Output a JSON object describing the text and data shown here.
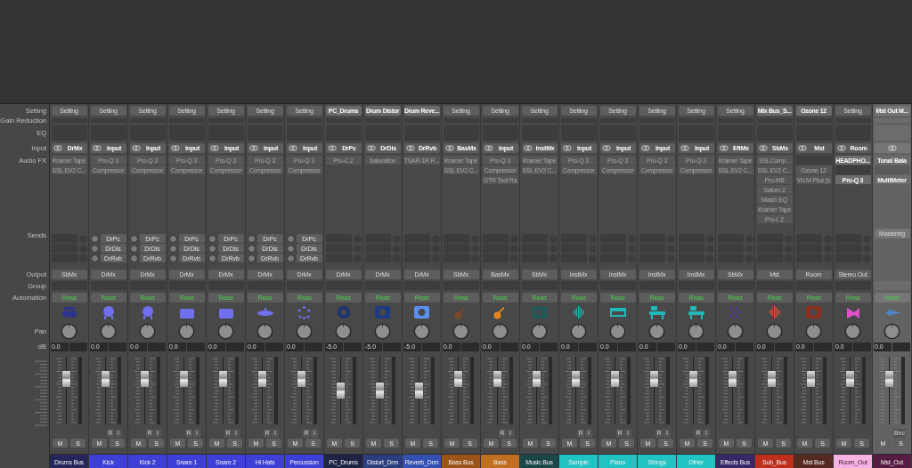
{
  "row_labels": {
    "setting": "Setting",
    "gain_reduction": "Gain Reduction",
    "eq": "EQ",
    "input": "Input",
    "audio_fx": "Audio FX",
    "sends": "Sends",
    "output": "Output",
    "group": "Group",
    "automation": "Automation",
    "pan": "Pan",
    "db": "dB"
  },
  "strips": [
    {
      "name": "Drums Bus",
      "color": "#25275a",
      "setting": "Setting",
      "setting_loaded": false,
      "input": "DrMx",
      "fx": [
        {
          "name": "Kramer Tape",
          "active": false
        },
        {
          "name": "SSL EV2 C...",
          "active": false
        }
      ],
      "output": "SbMx",
      "automation": "Read",
      "icon": {
        "kind": "drum-kit",
        "color": "#2d3290"
      },
      "db": "0.0",
      "level": 0.72,
      "ms": [
        "M",
        "S"
      ],
      "selected": false
    },
    {
      "name": "Kick",
      "color": "#3d3fd6",
      "setting": "Setting",
      "setting_loaded": false,
      "input": "Input",
      "fx": [
        {
          "name": "Pro-Q 3",
          "active": false
        },
        {
          "name": "Compressor",
          "active": false
        }
      ],
      "sends": [
        "DrPc",
        "DrDis",
        "DrRvb"
      ],
      "output": "DrMx",
      "automation": "Read",
      "icon": {
        "kind": "kick",
        "color": "#7070ee"
      },
      "db": "0.0",
      "level": 0.72,
      "extra": [
        "R",
        "I"
      ],
      "ms": [
        "M",
        "S"
      ],
      "selected": false
    },
    {
      "name": "Kick 2",
      "color": "#3d3fd6",
      "setting": "Setting",
      "setting_loaded": false,
      "input": "Input",
      "fx": [
        {
          "name": "Pro-Q 3",
          "active": false
        },
        {
          "name": "Compressor",
          "active": false
        }
      ],
      "sends": [
        "DrPc",
        "DrDis",
        "DrRvb"
      ],
      "output": "DrMx",
      "automation": "Read",
      "icon": {
        "kind": "kick",
        "color": "#7070ee"
      },
      "db": "0.0",
      "level": 0.72,
      "extra": [
        "R",
        "I"
      ],
      "ms": [
        "M",
        "S"
      ],
      "selected": false
    },
    {
      "name": "Snare 1",
      "color": "#3d3fd6",
      "setting": "Setting",
      "setting_loaded": false,
      "input": "Input",
      "fx": [
        {
          "name": "Pro-Q 3",
          "active": false
        },
        {
          "name": "Compressor",
          "active": false
        }
      ],
      "sends": [
        "DrPc",
        "DrDis",
        "DrRvb"
      ],
      "output": "DrMx",
      "automation": "Read",
      "icon": {
        "kind": "snare",
        "color": "#7070ee"
      },
      "db": "0.0",
      "level": 0.72,
      "extra": [
        "R",
        "I"
      ],
      "ms": [
        "M",
        "S"
      ],
      "selected": false
    },
    {
      "name": "Snare 2",
      "color": "#3d3fd6",
      "setting": "Setting",
      "setting_loaded": false,
      "input": "Input",
      "fx": [
        {
          "name": "Pro-Q 3",
          "active": false
        },
        {
          "name": "Compressor",
          "active": false
        }
      ],
      "sends": [
        "DrPc",
        "DrDis",
        "DrRvb"
      ],
      "output": "DrMx",
      "automation": "Read",
      "icon": {
        "kind": "snare",
        "color": "#7070ee"
      },
      "db": "0.0",
      "level": 0.72,
      "extra": [
        "R",
        "I"
      ],
      "ms": [
        "M",
        "S"
      ],
      "selected": false
    },
    {
      "name": "Hi Hats",
      "color": "#3d3fd6",
      "setting": "Setting",
      "setting_loaded": false,
      "input": "Input",
      "fx": [
        {
          "name": "Pro-Q 3",
          "active": false
        },
        {
          "name": "Compressor",
          "active": false
        }
      ],
      "sends": [
        "DrPc",
        "DrDis",
        "DrRvb"
      ],
      "output": "DrMx",
      "automation": "Read",
      "icon": {
        "kind": "cymbal",
        "color": "#7070ee"
      },
      "db": "0.0",
      "level": 0.72,
      "extra": [
        "R",
        "I"
      ],
      "ms": [
        "M",
        "S"
      ],
      "selected": false
    },
    {
      "name": "Percussion",
      "color": "#3d3fd6",
      "setting": "Setting",
      "setting_loaded": false,
      "input": "Input",
      "fx": [
        {
          "name": "Pro-Q 3",
          "active": false
        },
        {
          "name": "Compressor",
          "active": false
        }
      ],
      "sends": [
        "DrPc",
        "DrDis",
        "DrRvb"
      ],
      "output": "DrMx",
      "automation": "Read",
      "icon": {
        "kind": "percussion",
        "color": "#7070ee"
      },
      "db": "0.0",
      "level": 0.72,
      "extra": [
        "R",
        "I"
      ],
      "ms": [
        "M",
        "S"
      ],
      "selected": false
    },
    {
      "name": "PC_Drums",
      "color": "#1e2444",
      "setting": "PC_Drums",
      "setting_loaded": true,
      "input": "DrPc",
      "fx": [
        {
          "name": "Pro-C 2",
          "active": false
        }
      ],
      "output": "DrMx",
      "automation": "Read",
      "icon": {
        "kind": "knob",
        "color": "#1d3275"
      },
      "db": "-5.0",
      "level": 0.5,
      "ms": [
        "M",
        "S"
      ],
      "selected": false
    },
    {
      "name": "Distort_Drm",
      "color": "#2b3e7e",
      "setting": "Drum Distor",
      "setting_loaded": true,
      "input": "DrDis",
      "fx": [
        {
          "name": "Saturation",
          "active": false
        }
      ],
      "output": "DrMx",
      "automation": "Read",
      "icon": {
        "kind": "knob-box",
        "color": "#1d3a85"
      },
      "db": "-5.0",
      "level": 0.5,
      "ms": [
        "M",
        "S"
      ],
      "selected": false
    },
    {
      "name": "Reverb_Drm",
      "color": "#3450b5",
      "setting": "Drum Reve...",
      "setting_loaded": true,
      "input": "DrRvb",
      "fx": [
        {
          "name": "TSAR-1R R...",
          "active": false
        }
      ],
      "output": "DrMx",
      "automation": "Read",
      "icon": {
        "kind": "knob-box",
        "color": "#5c8ef0"
      },
      "db": "-5.0",
      "level": 0.5,
      "ms": [
        "M",
        "S"
      ],
      "selected": false
    },
    {
      "name": "Bass Bus",
      "color": "#9c5419",
      "setting": "Setting",
      "setting_loaded": false,
      "input": "BasMx",
      "fx": [
        {
          "name": "Kramer Tape",
          "active": false
        },
        {
          "name": "SSL EV2 C...",
          "active": false
        }
      ],
      "output": "SbMx",
      "automation": "Read",
      "icon": {
        "kind": "guitar",
        "color": "#7a4a2a"
      },
      "db": "0.0",
      "level": 0.72,
      "ms": [
        "M",
        "S"
      ],
      "selected": false
    },
    {
      "name": "Bass",
      "color": "#c06e20",
      "setting": "Setting",
      "setting_loaded": false,
      "input": "Input",
      "fx": [
        {
          "name": "Pro-Q 3",
          "active": false
        },
        {
          "name": "Compressor",
          "active": false
        },
        {
          "name": "GTR Tool Ra",
          "active": false
        }
      ],
      "output": "BasMx",
      "automation": "Read",
      "icon": {
        "kind": "guitar",
        "color": "#e8861e"
      },
      "db": "0.0",
      "level": 0.72,
      "extra": [
        "R",
        "I"
      ],
      "ms": [
        "M",
        "S"
      ],
      "selected": false
    },
    {
      "name": "Music Bus",
      "color": "#1b4747",
      "setting": "Setting",
      "setting_loaded": false,
      "input": "InstMx",
      "fx": [
        {
          "name": "Kramer Tape",
          "active": false
        },
        {
          "name": "SSL EV2 C...",
          "active": false
        }
      ],
      "output": "SbMx",
      "automation": "Read",
      "icon": {
        "kind": "speaker",
        "color": "#1c5a5a"
      },
      "db": "0.0",
      "level": 0.72,
      "ms": [
        "M",
        "S"
      ],
      "selected": false
    },
    {
      "name": "Sample",
      "color": "#22c3c3",
      "setting": "Setting",
      "setting_loaded": false,
      "input": "Input",
      "fx": [
        {
          "name": "Pro-Q 3",
          "active": false
        },
        {
          "name": "Compressor",
          "active": false
        }
      ],
      "output": "InstMx",
      "automation": "Read",
      "icon": {
        "kind": "waveform",
        "color": "#22b8b8"
      },
      "db": "0.0",
      "level": 0.72,
      "extra": [
        "R",
        "I"
      ],
      "ms": [
        "M",
        "S"
      ],
      "selected": false
    },
    {
      "name": "Piano",
      "color": "#22c3c3",
      "setting": "Setting",
      "setting_loaded": false,
      "input": "Input",
      "fx": [
        {
          "name": "Pro-Q 3",
          "active": false
        },
        {
          "name": "Compressor",
          "active": false
        }
      ],
      "output": "InstMx",
      "automation": "Read",
      "icon": {
        "kind": "keyboard",
        "color": "#22b8b8"
      },
      "db": "0.0",
      "level": 0.72,
      "extra": [
        "R",
        "I"
      ],
      "ms": [
        "M",
        "S"
      ],
      "selected": false
    },
    {
      "name": "Strings",
      "color": "#22c3c3",
      "setting": "Setting",
      "setting_loaded": false,
      "input": "Input",
      "fx": [
        {
          "name": "Pro-Q 3",
          "active": false
        },
        {
          "name": "Compressor",
          "active": false
        }
      ],
      "output": "InstMx",
      "automation": "Read",
      "icon": {
        "kind": "desk",
        "color": "#22b8b8"
      },
      "db": "0.0",
      "level": 0.72,
      "extra": [
        "R",
        "I"
      ],
      "ms": [
        "M",
        "S"
      ],
      "selected": false
    },
    {
      "name": "Other",
      "color": "#22c3c3",
      "setting": "Setting",
      "setting_loaded": false,
      "input": "Input",
      "fx": [
        {
          "name": "Pro-Q 3",
          "active": false
        },
        {
          "name": "Compressor",
          "active": false
        }
      ],
      "output": "InstMx",
      "automation": "Read",
      "icon": {
        "kind": "desk",
        "color": "#22b8b8"
      },
      "db": "0.0",
      "level": 0.72,
      "extra": [
        "R",
        "I"
      ],
      "ms": [
        "M",
        "S"
      ],
      "selected": false
    },
    {
      "name": "Effects Bus",
      "color": "#392867",
      "setting": "Setting",
      "setting_loaded": false,
      "input": "EftMx",
      "fx": [
        {
          "name": "Kramer Tape",
          "active": false
        },
        {
          "name": "SSL EV2 C...",
          "active": false
        }
      ],
      "output": "SbMx",
      "automation": "Read",
      "icon": {
        "kind": "dice",
        "color": "#5b36a8"
      },
      "db": "0.0",
      "level": 0.72,
      "ms": [
        "M",
        "S"
      ],
      "selected": false
    },
    {
      "name": "Sub_Bus",
      "color": "#bf2f1c",
      "setting": "Mix Bus_S...",
      "setting_loaded": true,
      "input": "SbMx",
      "fx": [
        {
          "name": "SSLComp...",
          "active": false
        },
        {
          "name": "SSL EV2 C...",
          "active": false
        },
        {
          "name": "Pro-MB",
          "active": false
        },
        {
          "name": "Saturn 2",
          "active": false
        },
        {
          "name": "Match EQ",
          "active": false
        },
        {
          "name": "Kramer Tape",
          "active": false
        },
        {
          "name": "Pro-L 2",
          "active": false
        }
      ],
      "output": "Mst",
      "automation": "Read",
      "icon": {
        "kind": "waveform",
        "color": "#e8502e"
      },
      "db": "0.0",
      "level": 0.72,
      "ms": [
        "M",
        "S"
      ],
      "selected": false
    },
    {
      "name": "Mst Bus",
      "color": "#552a20",
      "setting": "Ozone 12",
      "setting_loaded": true,
      "input": "Mst",
      "fx": [
        {
          "kind": "empty"
        },
        {
          "kind": "plugin",
          "name": "Ozone 12",
          "active": false
        },
        {
          "kind": "plugin",
          "name": "WLM Plus (s",
          "active": false
        }
      ],
      "output": "Room",
      "automation": "Read",
      "icon": {
        "kind": "knob-box",
        "color": "#8a2e1e"
      },
      "db": "0.0",
      "level": 0.72,
      "ms": [
        "M",
        "S"
      ],
      "selected": false
    },
    {
      "name": "Room_Out",
      "color": "#f6b2e2",
      "setting": "Setting",
      "setting_loaded": false,
      "input": "Room",
      "fx": [
        {
          "kind": "plugin",
          "name": "HEADPHO...",
          "active": true
        },
        {
          "kind": "empty"
        },
        {
          "kind": "plugin",
          "name": "Pro-Q 3",
          "active": true
        }
      ],
      "output": "Stereo Out",
      "automation": "Read",
      "icon": {
        "kind": "horn",
        "color": "#e050c8"
      },
      "db": "0.0",
      "level": 0.72,
      "ms": [
        "M",
        "S"
      ],
      "selected": false
    },
    {
      "name": "Mst_Out",
      "color": "#561c42",
      "setting": "Mst Out M...",
      "setting_loaded": true,
      "fx": [
        {
          "kind": "plugin",
          "name": "Tonal Bala",
          "active": true
        },
        {
          "kind": "empty"
        },
        {
          "kind": "plugin",
          "name": "MultiMeter",
          "active": true
        }
      ],
      "sends_button": "Mastering",
      "automation": "Read",
      "icon": {
        "kind": "wave-box",
        "color": "#4a8ad8"
      },
      "db": "0.0",
      "level": 0.72,
      "extra": [
        "Bnc"
      ],
      "ms": [
        "M",
        "S"
      ],
      "selected": true
    }
  ]
}
